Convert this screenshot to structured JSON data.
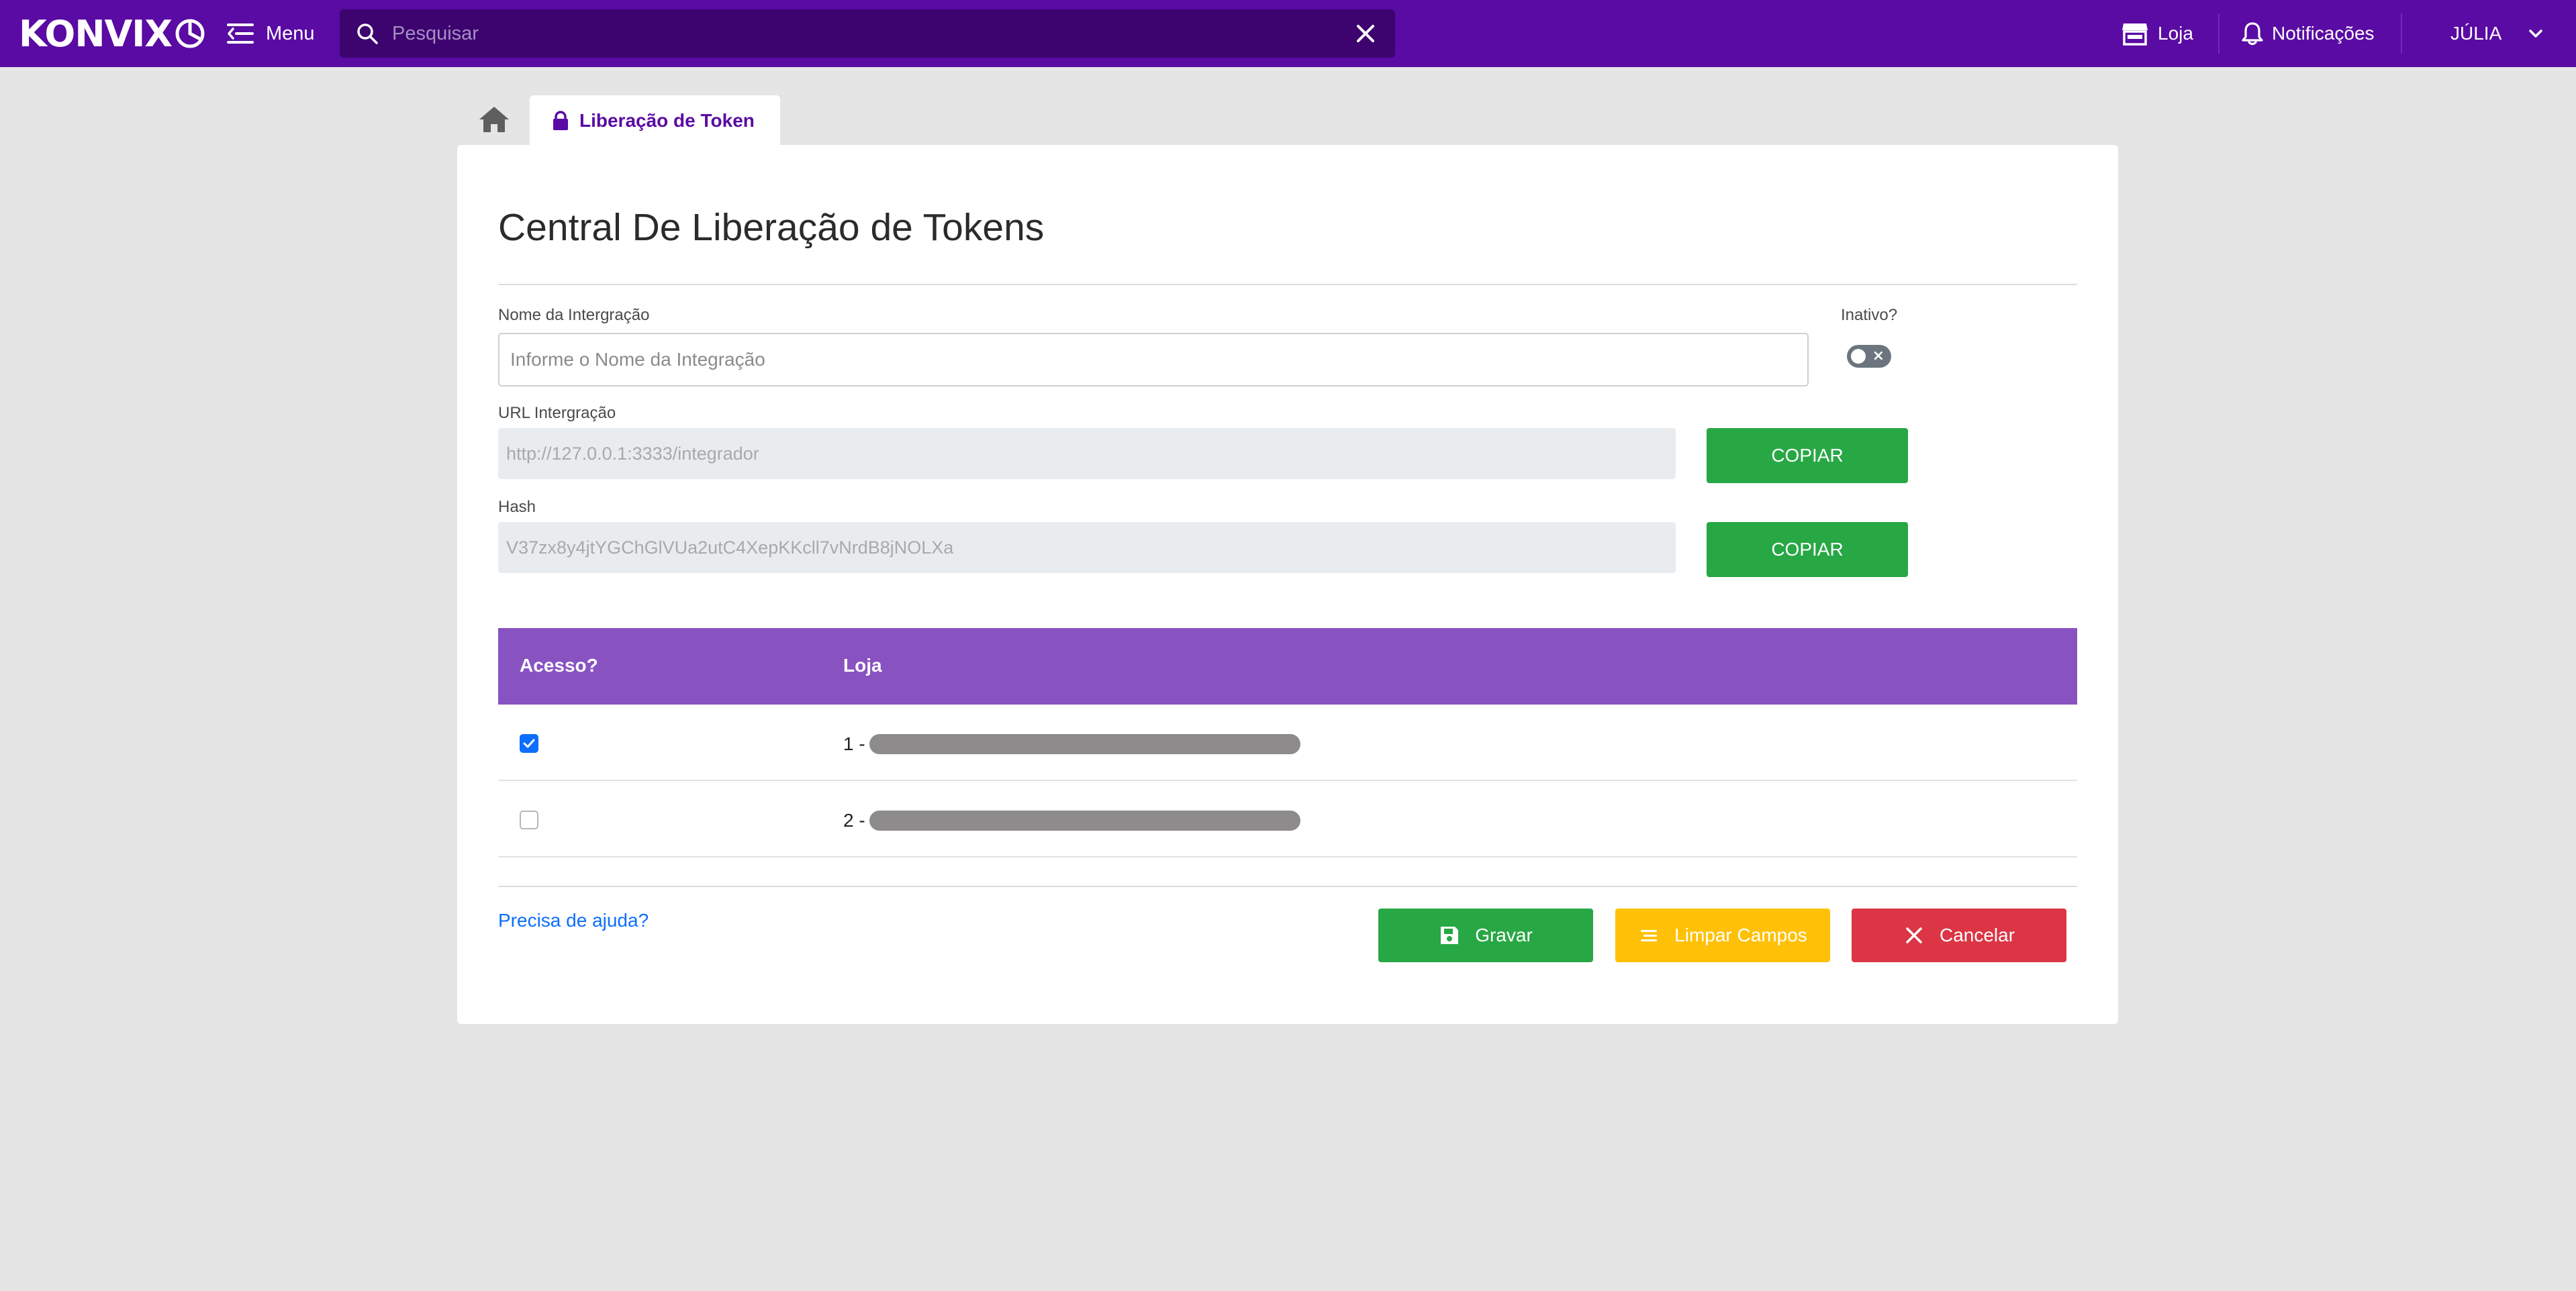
{
  "app": {
    "logo_text": "KONVIX"
  },
  "topbar": {
    "menu_label": "Menu",
    "search_placeholder": "Pesquisar",
    "store_label": "Loja",
    "notifications_label": "Notificações",
    "user_label": "JÚLIA"
  },
  "tabs": {
    "active_label": "Liberação de Token"
  },
  "page": {
    "title": "Central De Liberação de Tokens"
  },
  "form": {
    "name_label": "Nome da Intergração",
    "name_placeholder": "Informe o Nome da Integração",
    "name_value": "",
    "inactive_label": "Inativo?",
    "inactive_on": false,
    "url_label": "URL Intergração",
    "url_value": "http://127.0.0.1:3333/integrador",
    "hash_label": "Hash",
    "hash_value": "V37zx8y4jtYGChGlVUa2utC4XepKKcll7vNrdB8jNOLXa",
    "copy_label": "COPIAR"
  },
  "table": {
    "headers": [
      "Acesso?",
      "Loja"
    ],
    "rows": [
      {
        "checked": true,
        "store_prefix": "1 -"
      },
      {
        "checked": false,
        "store_prefix": "2 -"
      }
    ]
  },
  "footer": {
    "help_label": "Precisa de ajuda?",
    "save_label": "Gravar",
    "clear_label": "Limpar Campos",
    "cancel_label": "Cancelar"
  },
  "colors": {
    "topbar": "#5a0ba3",
    "table_header": "#8952c1",
    "success": "#28a745",
    "warning": "#ffc107",
    "danger": "#dc3545"
  },
  "icons": [
    "logo-mark-icon",
    "menu-icon",
    "search-icon",
    "close-icon",
    "store-icon",
    "bell-icon",
    "chevron-down-icon",
    "home-icon",
    "lock-icon",
    "check-icon",
    "save-icon",
    "clear-lines-icon",
    "x-icon"
  ]
}
